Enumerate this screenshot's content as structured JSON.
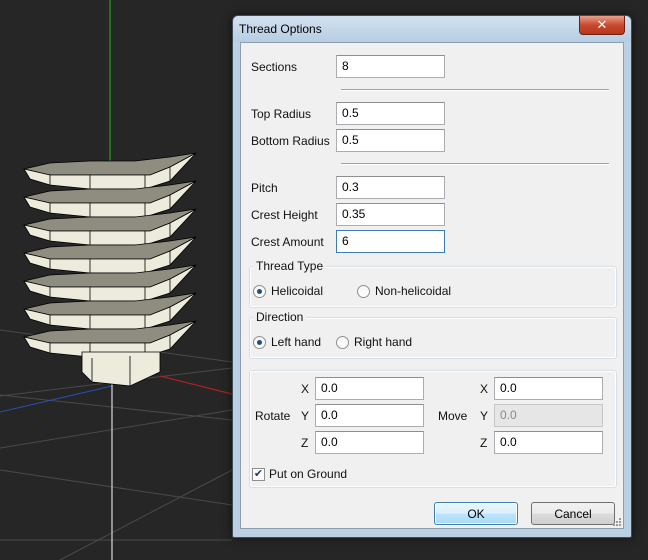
{
  "dialog": {
    "title": "Thread Options",
    "close_glyph": "✕"
  },
  "fields": {
    "sections": {
      "label": "Sections",
      "value": "8"
    },
    "top_radius": {
      "label": "Top Radius",
      "value": "0.5"
    },
    "bottom_radius": {
      "label": "Bottom Radius",
      "value": "0.5"
    },
    "pitch": {
      "label": "Pitch",
      "value": "0.3"
    },
    "crest_height": {
      "label": "Crest Height",
      "value": "0.35"
    },
    "crest_amount": {
      "label": "Crest Amount",
      "value": "6"
    }
  },
  "thread_type": {
    "title": "Thread Type",
    "options": [
      "Helicoidal",
      "Non-helicoidal"
    ],
    "selected": "Helicoidal"
  },
  "direction": {
    "title": "Direction",
    "options": [
      "Left hand",
      "Right hand"
    ],
    "selected": "Left hand"
  },
  "transform": {
    "rotate_label": "Rotate",
    "move_label": "Move",
    "axis_x": "X",
    "axis_y": "Y",
    "axis_z": "Z",
    "rotate": {
      "x": "0.0",
      "y": "0.0",
      "z": "0.0"
    },
    "move": {
      "x": "0.0",
      "y": "0.0",
      "z": "0.0"
    }
  },
  "put_on_ground": {
    "label": "Put on Ground",
    "checked": true,
    "check_glyph": "✔"
  },
  "buttons": {
    "ok": "OK",
    "cancel": "Cancel"
  },
  "colors": {
    "viewport_bg": "#262626",
    "thread_face_light": "#ecebdc",
    "thread_face_dark": "#8e8d80",
    "axis_green": "#1ea81e",
    "axis_red": "#b01e1e",
    "grid_line": "#4a4a4a",
    "dialog_frame": "#bcd0e4",
    "close_button": "#c74a30"
  },
  "icons": [
    "close-icon",
    "radio-selected-icon",
    "radio-unselected-icon",
    "checkbox-checked-icon",
    "resize-grip-icon"
  ]
}
